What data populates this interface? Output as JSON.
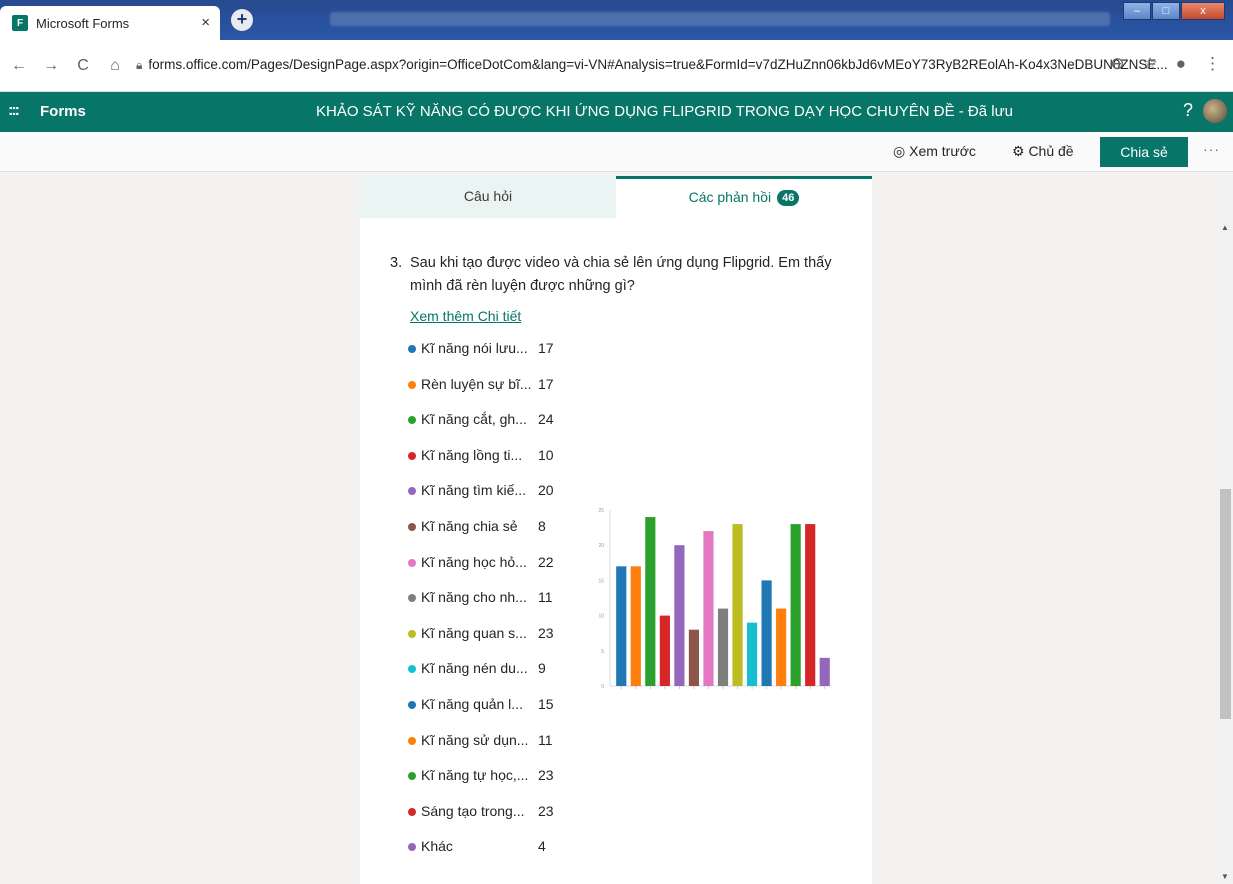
{
  "browser": {
    "tab_title": "Microsoft Forms",
    "tab_close": "×",
    "new_tab": "+",
    "url": "forms.office.com/Pages/DesignPage.aspx?origin=OfficeDotCom&lang=vi-VN#Analysis=true&FormId=v7dZHuZnn06kbJd6vMEoY73RyB2REolAh-Ko4x3NeDBUN0ZNSE...",
    "back": "←",
    "forward": "→",
    "reload": "C",
    "home": "⌂",
    "zoom_icon": "⊖",
    "star_icon": "☆",
    "profile_icon": "●",
    "menu_icon": "⋮"
  },
  "header": {
    "waffle": ":::",
    "brand": "Forms",
    "form_title": "KHẢO SÁT KỸ NĂNG CÓ ĐƯỢC KHI ỨNG DỤNG FLIPGRID TRONG DẠY HỌC CHUYÊN ĐỀ - Đã lưu",
    "help": "?"
  },
  "toolbar": {
    "preview_label": "◎ Xem trước",
    "theme_label": "⚙ Chủ đề",
    "share_label": "Chia sẻ",
    "more_label": "···"
  },
  "tabs": {
    "questions": "Câu hỏi",
    "responses": "Các phản hồi",
    "responses_count": "46"
  },
  "question": {
    "number": "3.",
    "text": "Sau khi tạo được video và chia sẻ lên ứng dụng Flipgrid. Em thấy mình đã rèn luyện được những gì?",
    "details_link": "Xem thêm Chi tiết"
  },
  "colors": {
    "brand": "#077568",
    "series": [
      "#1f77b4",
      "#ff7f0e",
      "#2ca02c",
      "#d62728",
      "#9467bd",
      "#8c564b",
      "#e377c2",
      "#7f7f7f",
      "#bcbd22",
      "#17becf",
      "#1f77b4",
      "#ff7f0e",
      "#2ca02c",
      "#d62728",
      "#9467bd"
    ]
  },
  "chart_data": {
    "type": "bar",
    "categories": [
      "Kĩ năng nói lưu...",
      "Rèn luyện sự bĩ...",
      "Kĩ năng cắt, gh...",
      "Kĩ năng lồng ti...",
      "Kĩ năng tìm kiế...",
      "Kĩ năng chia sẻ",
      "Kĩ năng học hỏ...",
      "Kĩ năng cho nh...",
      "Kĩ năng quan s...",
      "Kĩ năng nén du...",
      "Kĩ năng quản l...",
      "Kĩ năng sử dụn...",
      "Kĩ năng tự học,...",
      "Sáng tạo trong...",
      "Khác"
    ],
    "values": [
      17,
      17,
      24,
      10,
      20,
      8,
      22,
      11,
      23,
      9,
      15,
      11,
      23,
      23,
      4
    ],
    "ylim": [
      0,
      25
    ],
    "yticks": [
      "0",
      "5",
      "10",
      "15",
      "20",
      "25"
    ],
    "grid": false
  }
}
